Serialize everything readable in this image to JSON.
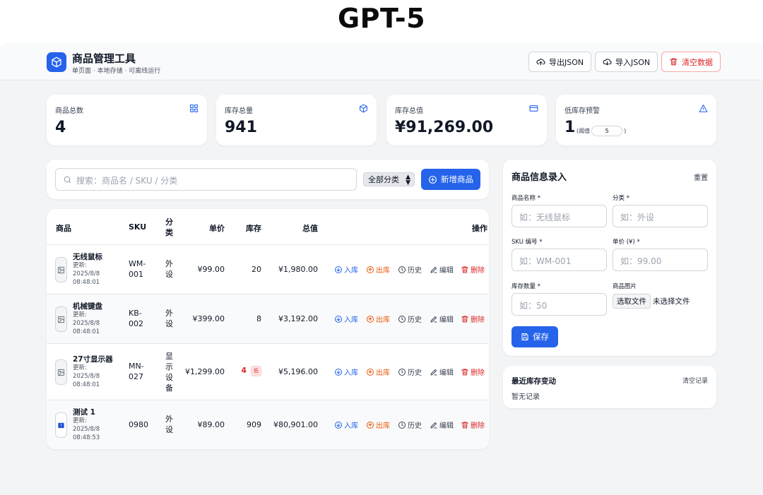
{
  "banner": {
    "title": "GPT-5"
  },
  "app": {
    "title": "商品管理工具",
    "subtitle": "单页面 · 本地存储 · 可离线运行",
    "export_label": "导出JSON",
    "import_label": "导入JSON",
    "clear_label": "清空数据"
  },
  "stats": {
    "total_products": {
      "label": "商品总数",
      "value": "4"
    },
    "total_stock": {
      "label": "库存总量",
      "value": "941"
    },
    "total_value": {
      "label": "库存总值",
      "value": "¥91,269.00"
    },
    "low_stock": {
      "label": "低库存预警",
      "value": "1",
      "threshold_prefix": "(阈值",
      "threshold_value": "5",
      "threshold_suffix": ")"
    }
  },
  "toolbar": {
    "search_placeholder": "搜索：商品名 / SKU / 分类",
    "category_selected": "全部分类",
    "add_label": "新增商品"
  },
  "table": {
    "headers": {
      "product": "商品",
      "sku": "SKU",
      "category": "分类",
      "price": "单价",
      "stock": "库存",
      "value": "总值",
      "actions": "操作"
    },
    "actions": {
      "in": "入库",
      "out": "出库",
      "history": "历史",
      "edit": "编辑",
      "delete": "删除"
    },
    "low_badge": "低",
    "rows": [
      {
        "name": "无线鼠标",
        "updated": "更新: 2025/8/8 08:48:01",
        "sku": "WM-001",
        "category": "外设",
        "price": "¥99.00",
        "stock": "20",
        "value": "¥1,980.00"
      },
      {
        "name": "机械键盘",
        "updated": "更新: 2025/8/8 08:48:01",
        "sku": "KB-002",
        "category": "外设",
        "price": "¥399.00",
        "stock": "8",
        "value": "¥3,192.00"
      },
      {
        "name": "27寸显示器",
        "updated": "更新: 2025/8/8 08:48:01",
        "sku": "MN-027",
        "category": "显示设备",
        "price": "¥1,299.00",
        "stock": "4",
        "value": "¥5,196.00"
      },
      {
        "name": "测试 1",
        "updated": "更新: 2025/8/8 08:48:53",
        "sku": "0980",
        "category": "外设",
        "price": "¥89.00",
        "stock": "909",
        "value": "¥80,901.00"
      }
    ]
  },
  "form": {
    "title": "商品信息录入",
    "reset_label": "重置",
    "name_label": "商品名称 *",
    "name_placeholder": "如：无线鼠标",
    "category_label": "分类 *",
    "category_placeholder": "如：外设",
    "sku_label": "SKU 编号 *",
    "sku_placeholder": "如：WM-001",
    "price_label": "单价 (¥) *",
    "price_placeholder": "如：99.00",
    "qty_label": "库存数量 *",
    "qty_placeholder": "如：50",
    "image_label": "商品图片",
    "file_button": "选取文件",
    "file_status": "未选择文件",
    "save_label": "保存"
  },
  "log": {
    "title": "最近库存变动",
    "clear_label": "清空记录",
    "empty_text": "暂无记录"
  }
}
